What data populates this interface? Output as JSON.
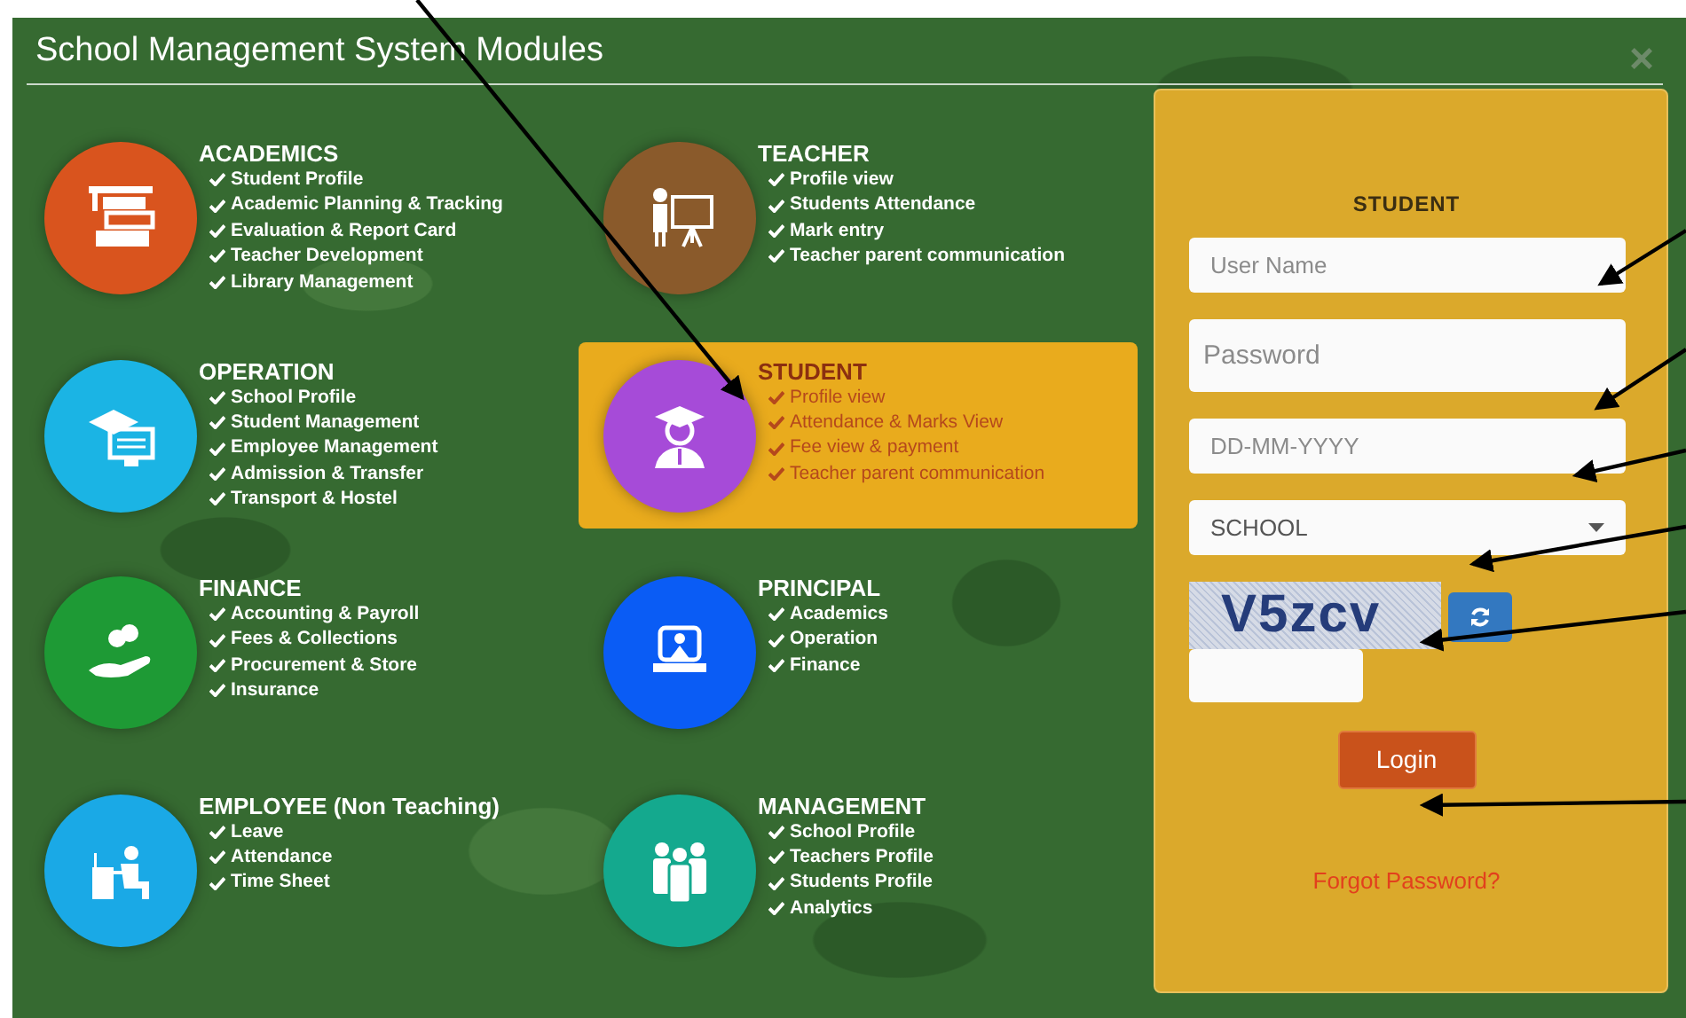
{
  "window": {
    "title": "School Management System Modules",
    "close": "×"
  },
  "modules": [
    {
      "title": "ACADEMICS",
      "color": "#d9541e",
      "selected": false,
      "features": [
        "Student Profile",
        "Academic Planning & Tracking",
        "Evaluation & Report Card",
        "Teacher Development",
        "Library Management"
      ]
    },
    {
      "title": "TEACHER",
      "color": "#8a5a2b",
      "selected": false,
      "features": [
        "Profile view",
        "Students Attendance",
        "Mark entry",
        "Teacher parent communication"
      ]
    },
    {
      "title": "OPERATION",
      "color": "#1bb4e4",
      "selected": false,
      "features": [
        "School Profile",
        "Student Management",
        "Employee Management",
        "Admission & Transfer",
        "Transport & Hostel"
      ]
    },
    {
      "title": "STUDENT",
      "color": "#a64bd8",
      "selected": true,
      "features": [
        "Profile view",
        "Attendance & Marks View",
        "Fee view & payment",
        "Teacher parent communication"
      ]
    },
    {
      "title": "FINANCE",
      "color": "#1e9a35",
      "selected": false,
      "features": [
        "Accounting & Payroll",
        "Fees & Collections",
        "Procurement & Store",
        "Insurance"
      ]
    },
    {
      "title": "PRINCIPAL",
      "color": "#0a5cf5",
      "selected": false,
      "features": [
        "Academics",
        "Operation",
        "Finance"
      ]
    },
    {
      "title": "EMPLOYEE (Non Teaching)",
      "color": "#1aa9e6",
      "selected": false,
      "features": [
        "Leave",
        "Attendance",
        "Time Sheet"
      ]
    },
    {
      "title": "MANAGEMENT",
      "color": "#14a98e",
      "selected": false,
      "features": [
        "School Profile",
        "Teachers Profile",
        "Students Profile",
        "Analytics"
      ]
    }
  ],
  "login": {
    "heading": "STUDENT",
    "fields": [
      {
        "kind": "text",
        "placeholder": "User Name"
      },
      {
        "kind": "password",
        "placeholder": "Password"
      },
      {
        "kind": "text",
        "placeholder": "DD-MM-YYYY"
      },
      {
        "kind": "select",
        "value": "SCHOOL"
      }
    ],
    "captcha": "V5zcv",
    "login_button": "Login",
    "forgot_link": "Forgot Password?"
  }
}
